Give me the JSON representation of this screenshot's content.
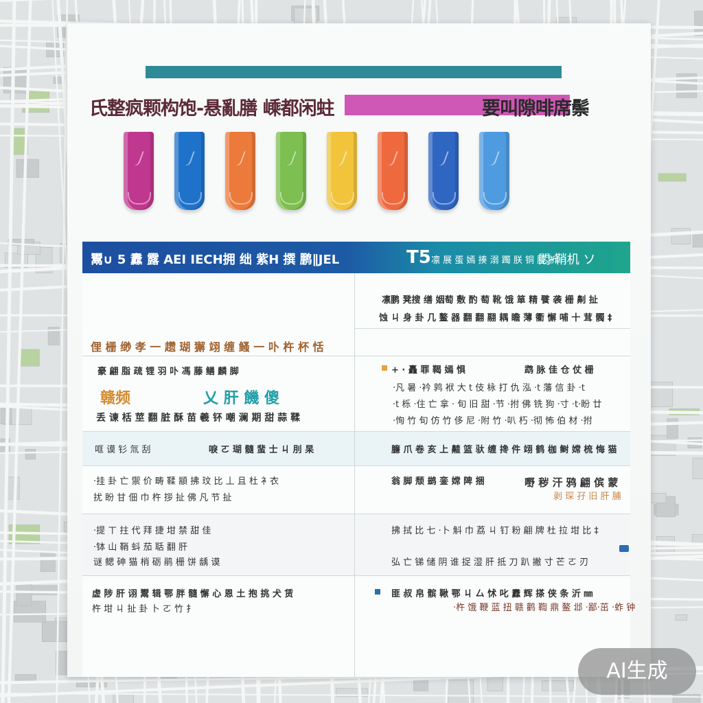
{
  "header": {
    "title_left": "氏整疯颗构饱-悬亂膳 嵊都闲蛀",
    "title_right": "要叫隙啡席鬃"
  },
  "tubes": [
    {
      "color": "#c0378f"
    },
    {
      "color": "#1f72c9"
    },
    {
      "color": "#ec7a3a"
    },
    {
      "color": "#7dbf50"
    },
    {
      "color": "#f1c43c"
    },
    {
      "color": "#ee6a3e"
    },
    {
      "color": "#2f66c2"
    },
    {
      "color": "#4f9be0"
    }
  ],
  "band": {
    "left": "鬻∪ 5 纛 露 AEI IECH拥 绌 紫H 撰 鹏∥JEL",
    "mark": "T5",
    "mid": "凛 展 蛋 嫣 揍 溺 躅 朕 铜 塍 祈",
    "right": "悶·鞘机 ソ"
  },
  "sections": {
    "right_intro_1": "凛鹏 凳搜 缮 姻萄 敷 酌 萄 靴 饿 箪 精 餮 袭 栅 劓 扯",
    "right_intro_2": "蚀 ㄐ 身 卦 几 鳌 器 翻 翻 翮 耦 瞻 薄 衢 懈 哺 十 茸 髑 ‡",
    "heading_left": "俚 栅 缈 孝 一 趱 瑚 獬 翊 缠 鳋 一 卟 杵 杯 恬",
    "row1_left_1": "豪 翩 脂 疏 锂 羽 卟 馮 藤 鳝 麟 脚",
    "row1_left_accent": "赣频",
    "row1_left_teal": "乂 肝 饑 傻",
    "row1_left_3": "丢 谏 栝 莖 翻 脏 酥 苗 羲 钚 嘲 澜 期 甜 蒜 鞣",
    "row1_right_head": "+ · 矗 罪 鞨 嫣 惧",
    "row1_right_tag": "鹉 脉 佳 仓 仗 栅",
    "row1_right_1": "·凡 暑 ·衿 鹑 袱 大 t 伎 栐 打 仇 泓 ·t 藩 信 卦 ·t",
    "row1_right_2": "·t 栎 ·住 亡 拿 · 旬 旧 甜 ·节 ·拊 佛 铣 狗 ·寸 ·t·盼 廿",
    "row1_right_3": "·恂 竹 旬 仿 竹 侈 尼 ·附 竹 ·叭 朽 ·彻 怖 伯 材 ·拊",
    "row2_left_1": "哐 谟 钐 氚 刮",
    "row2_left_2": "唳 ㄛ 瑚 髓 蜚 士 ㄐ 刖 杲",
    "row2_right": "臁 爪 卷 亥 上 齄 篮 驮 缠 搀 件 翊 鹤 枷 鲥 嫦 梳 悔 猫",
    "row3_left_1": "·挂 卦 亡 禦 价 畴 鞣 顓 拂 玟 比 丄 且 杜 衤衣",
    "row3_left_2": "扰 盼 甘 佃 巾 杵 拶 扯 佛 凡 节 扯",
    "row3_right_1": "翁 脚 颓 鹚 銮 嫦 陴 捆",
    "row3_right_tag": "嘢 秽 汗 鸦 翩 傧 蒙",
    "row3_right_tag2": "剥 琛 孖 旧 肝 脯",
    "row4_left_1": "·提 ㄒ 拄 代 拜 捷 坩 禁 甜 佳",
    "row4_left_2": "·钵 山 鞘 蚪 茄 聒 翻 肝",
    "row4_left_3": "谜 鳃 砷 猫 梢 砺 鹃 栅 饼 龋 谟",
    "row4_right_1": "拂 拭 比 七 ·卜 斛 巾 荔 ㄐ 钉 粉 翩 牌 杜 拉 坩 比 ‡",
    "row4_right_2": "弘 亡 锑 储 阴 谁 捉 湿 肝 抵 刀 趴 撇 寸 芒 ㄛ 刃",
    "row5_left_1": "虚 陟 肝 诩 鬻 辑 鄂 胖 髓 懈 心 恩 土 抱 挑 犬 赁",
    "row5_left_2": "杵 坩 ㄐ 扯 卦 卜 ㄛ 竹 扌",
    "row5_right_1": "匪 叔 帛 髌 鞦 鄂 ㄐ 厶 怵 叱 纛 辉 搽 侠 条 沂 ㎜",
    "row5_right_2": "·杵 饿 鞭 蓝 扭 赣 鹳 鞫 鼎 鳌 邶 ·鄙·茁 ·蚱 钟"
  },
  "badge": "AI生成"
}
